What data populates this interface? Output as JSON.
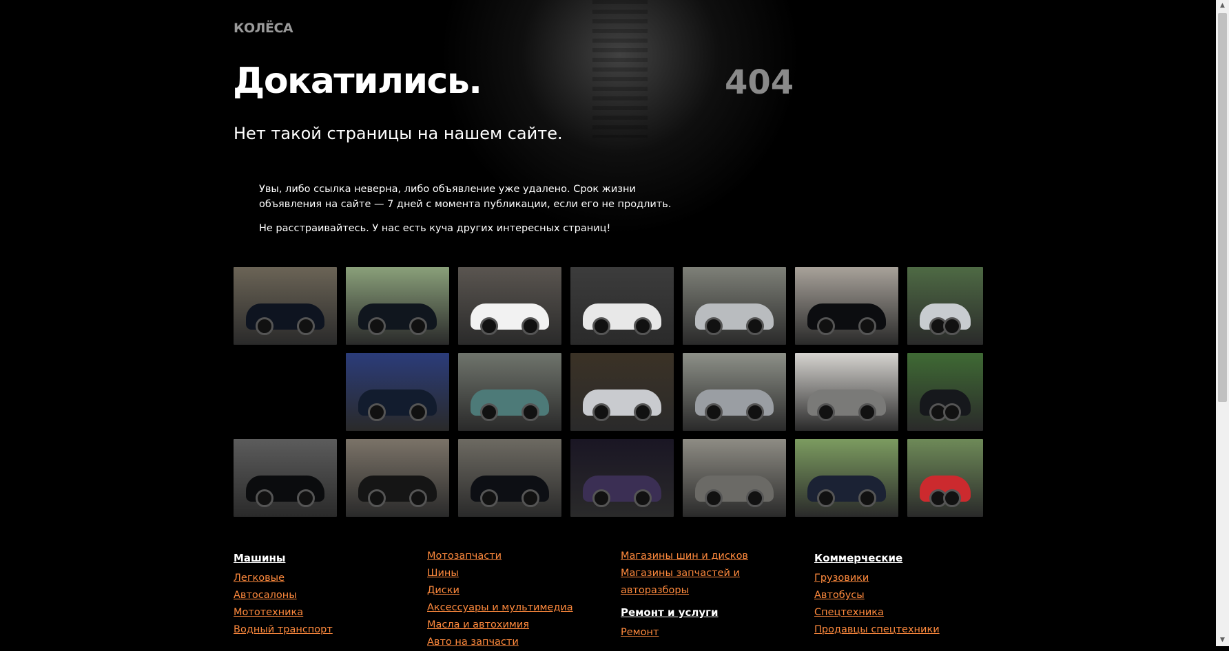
{
  "logo": "КОЛЁСА",
  "headline": "Докатились.",
  "error_code": "404",
  "subtitle": "Нет такой страницы на нашем сайте.",
  "explanation": {
    "line1": "Увы, либо ссылка неверна, либо объявление уже удалено. Срок жизни объявления на сайте — 7 дней с момента публикации, если его не продлить.",
    "line2": "Не расстраивайтесь. У нас есть куча других интересных страниц!"
  },
  "colors": {
    "background": "#000000",
    "link": "#ff8a3d",
    "error_code": "#8a8a8a",
    "logo": "#9a9a9a"
  },
  "gallery": [
    {
      "bg": "#6b6456",
      "car": "#0e1420"
    },
    {
      "bg": "#8aa07a",
      "car": "#10161e"
    },
    {
      "bg": "#5a5550",
      "car": "#f2f2f2"
    },
    {
      "bg": "#3c3c3c",
      "car": "#e8e8e8"
    },
    {
      "bg": "#7e8078",
      "car": "#b9bcbf"
    },
    {
      "bg": "#a8a29a",
      "car": "#0c0d10"
    },
    {
      "bg": "#4e6a44",
      "car": "#c8ccd0"
    },
    {
      "bg": "#2b3c7a",
      "car": "#121c2e"
    },
    {
      "bg": "#6f746c",
      "car": "#4d7a78"
    },
    {
      "bg": "#3b3226",
      "car": "#c9cbcf"
    },
    {
      "bg": "#8d9088",
      "car": "#9a9ea3"
    },
    {
      "bg": "#d6d4d0",
      "car": "#7a7a78"
    },
    {
      "bg": "#3f6a34",
      "car": "#16181c"
    },
    {
      "bg": "#5c5c5c",
      "car": "#0b0c0e"
    },
    {
      "bg": "#7b7368",
      "car": "#151515"
    },
    {
      "bg": "#6d6a62",
      "car": "#0d0f14"
    },
    {
      "bg": "#1a1624",
      "car": "#3b2f54"
    },
    {
      "bg": "#8e8c84",
      "car": "#6b6a66"
    },
    {
      "bg": "#7c9c60",
      "car": "#1b2234"
    },
    {
      "bg": "#6e8a58",
      "car": "#cc2a2e"
    }
  ],
  "footer": {
    "col1": {
      "head": "Машины",
      "links": [
        "Легковые",
        "Автосалоны",
        "Мототехника",
        "Водный транспорт"
      ]
    },
    "col2": {
      "links": [
        "Мотозапчасти",
        "Шины",
        "Диски",
        "Аксессуары и мультимедиа",
        "Масла и автохимия",
        "Авто на запчасти"
      ]
    },
    "col3": {
      "links": [
        "Магазины шин и дисков",
        "Магазины запчастей и авторазборы"
      ],
      "head2": "Ремонт и услуги",
      "links2": [
        "Ремонт"
      ]
    },
    "col4": {
      "head": "Коммерческие",
      "links": [
        "Грузовики",
        "Автобусы",
        "Спецтехника",
        "Продавцы спецтехники"
      ]
    }
  },
  "scrollbar": {
    "up_icon": "triangle-up",
    "down_icon": "triangle-down"
  }
}
